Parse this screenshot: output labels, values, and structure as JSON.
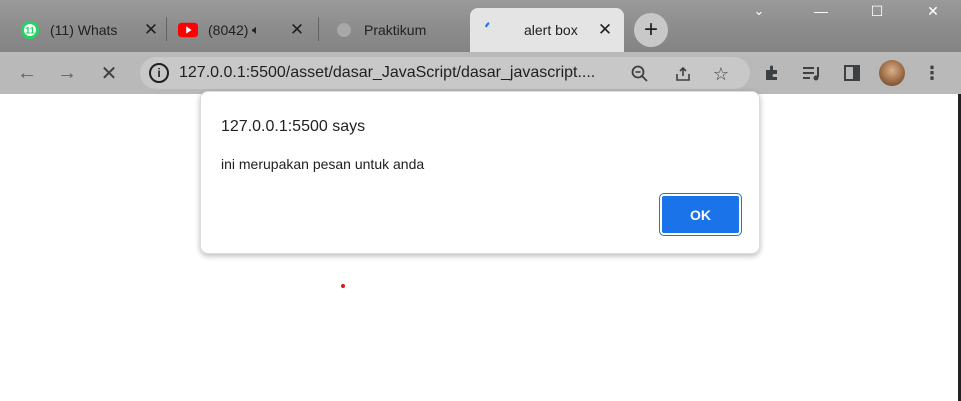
{
  "browser": {
    "tabs": [
      {
        "title": "(11) Whats",
        "favicon": "whatsapp-icon",
        "badge": "11"
      },
      {
        "title": "(8042)",
        "favicon": "youtube-icon",
        "audio": true
      },
      {
        "title": "Praktikum",
        "favicon": "page-icon"
      },
      {
        "title": "alert box",
        "favicon": "loading-icon",
        "active": true
      }
    ],
    "new_tab": "+",
    "url": "127.0.0.1:5500/asset/dasar_JavaScript/dasar_javascript....",
    "colors": {
      "accent": "#1a73e8",
      "titlebar": "#8b8b8b",
      "toolbar": "#b9b9b9",
      "active_tab": "#e4e4e4"
    }
  },
  "dialog": {
    "title": "127.0.0.1:5500 says",
    "message": "ini merupakan pesan untuk anda",
    "ok_label": "OK"
  }
}
